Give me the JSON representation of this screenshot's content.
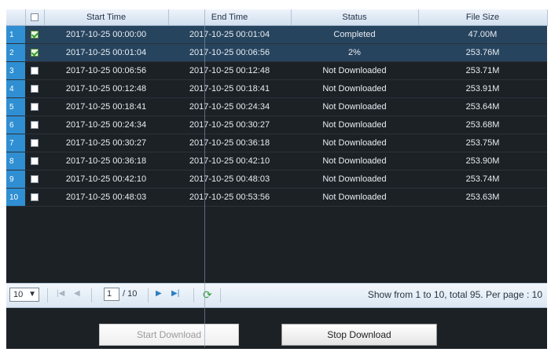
{
  "table": {
    "columns": [
      "",
      "",
      "Start Time",
      "End Time",
      "Status",
      "File Size"
    ],
    "rows": [
      {
        "no": "1",
        "checked": true,
        "start": "2017-10-25 00:00:00",
        "end": "2017-10-25 00:01:04",
        "status": "Completed",
        "size": "47.00M"
      },
      {
        "no": "2",
        "checked": true,
        "start": "2017-10-25 00:01:04",
        "end": "2017-10-25 00:06:56",
        "status": "2%",
        "size": "253.76M"
      },
      {
        "no": "3",
        "checked": false,
        "start": "2017-10-25 00:06:56",
        "end": "2017-10-25 00:12:48",
        "status": "Not Downloaded",
        "size": "253.71M"
      },
      {
        "no": "4",
        "checked": false,
        "start": "2017-10-25 00:12:48",
        "end": "2017-10-25 00:18:41",
        "status": "Not Downloaded",
        "size": "253.91M"
      },
      {
        "no": "5",
        "checked": false,
        "start": "2017-10-25 00:18:41",
        "end": "2017-10-25 00:24:34",
        "status": "Not Downloaded",
        "size": "253.64M"
      },
      {
        "no": "6",
        "checked": false,
        "start": "2017-10-25 00:24:34",
        "end": "2017-10-25 00:30:27",
        "status": "Not Downloaded",
        "size": "253.68M"
      },
      {
        "no": "7",
        "checked": false,
        "start": "2017-10-25 00:30:27",
        "end": "2017-10-25 00:36:18",
        "status": "Not Downloaded",
        "size": "253.75M"
      },
      {
        "no": "8",
        "checked": false,
        "start": "2017-10-25 00:36:18",
        "end": "2017-10-25 00:42:10",
        "status": "Not Downloaded",
        "size": "253.90M"
      },
      {
        "no": "9",
        "checked": false,
        "start": "2017-10-25 00:42:10",
        "end": "2017-10-25 00:48:03",
        "status": "Not Downloaded",
        "size": "253.74M"
      },
      {
        "no": "10",
        "checked": false,
        "start": "2017-10-25 00:48:03",
        "end": "2017-10-25 00:53:56",
        "status": "Not Downloaded",
        "size": "253.63M"
      }
    ]
  },
  "pager": {
    "page_size": "10",
    "current_page": "1",
    "total_pages": "/ 10",
    "info": "Show from 1 to 10, total 95. Per page : 10"
  },
  "buttons": {
    "start_download": "Start Download",
    "stop_download": "Stop Download"
  },
  "colors": {
    "panel_bg": "#1c2126",
    "row_number_bg": "#2f8fd2",
    "selected_row_bg": "#27445e"
  }
}
